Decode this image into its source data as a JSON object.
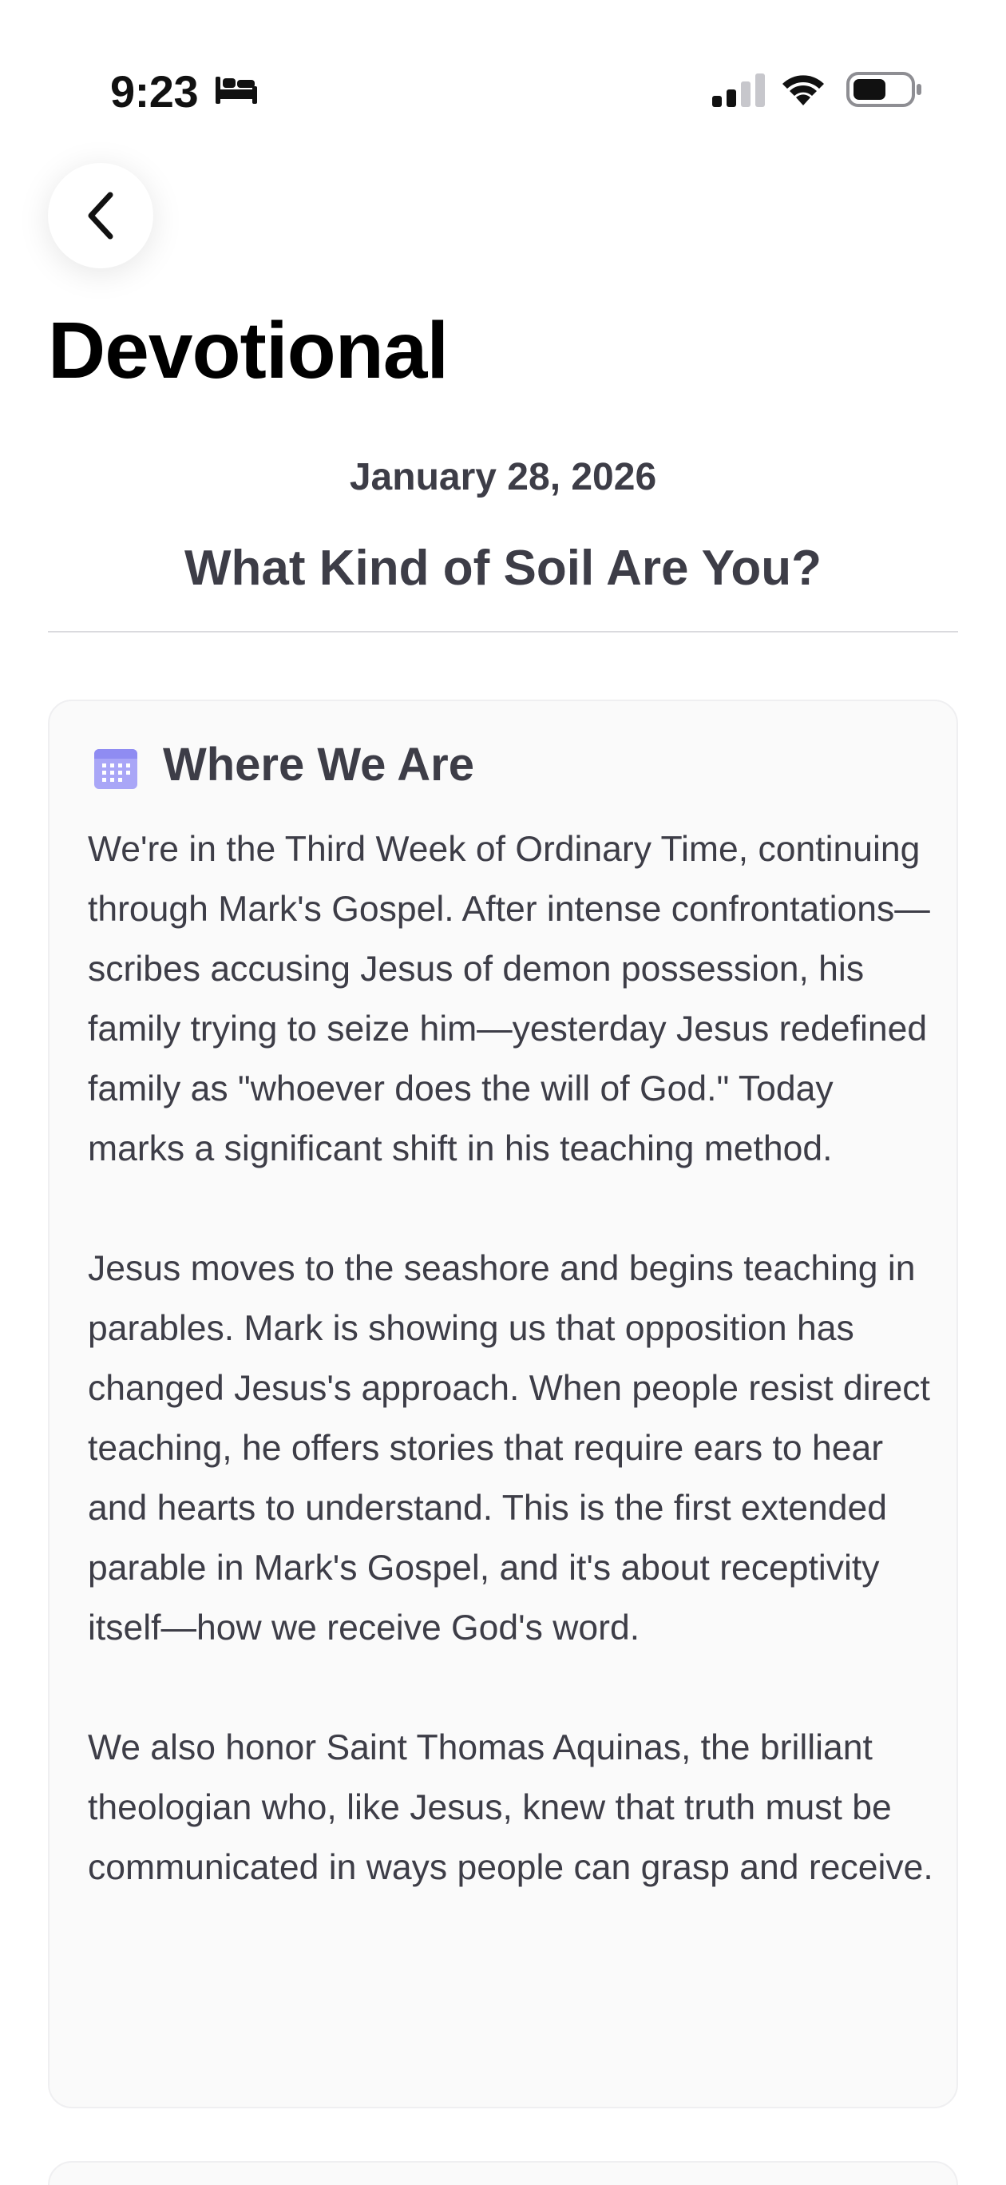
{
  "status_bar": {
    "time": "9:23",
    "icons": [
      "bed-icon",
      "signal-icon",
      "wifi-icon",
      "battery-icon"
    ]
  },
  "nav": {
    "back_icon": "chevron-left-icon"
  },
  "page": {
    "title": "Devotional",
    "date": "January 28, 2026",
    "devotional_title": "What Kind of Soil Are You?"
  },
  "section": {
    "icon": "calendar-icon",
    "icon_color": "#8f8cf2",
    "title": "Where We Are",
    "paragraphs": [
      "We're in the Third Week of Ordinary Time, continuing through Mark's Gospel. After intense confrontations—scribes accusing Jesus of demon possession, his family trying to seize him—yesterday Jesus redefined family as \"whoever does the will of God.\" Today marks a significant shift in his teaching method.",
      "Jesus moves to the seashore and begins teaching in parables. Mark is showing us that opposition has changed Jesus's approach. When people resist direct teaching, he offers stories that require ears to hear and hearts to understand. This is the first extended parable in Mark's Gospel, and it's about receptivity itself—how we receive God's word.",
      "We also honor Saint Thomas Aquinas, the brilliant theologian who, like Jesus, knew that truth must be communicated in ways people can grasp and receive."
    ]
  }
}
